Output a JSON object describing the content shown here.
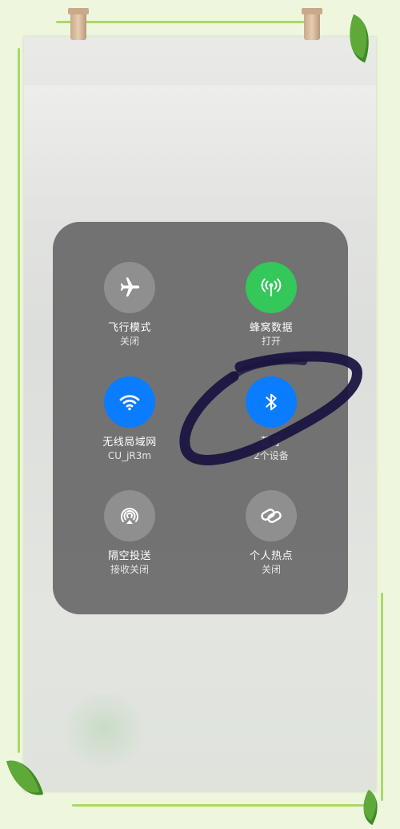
{
  "panel": {
    "tiles": [
      {
        "label": "飞行模式",
        "status": "关闭",
        "icon": "airplane-icon",
        "state": "off"
      },
      {
        "label": "蜂窝数据",
        "status": "打开",
        "icon": "cellular-antenna-icon",
        "state": "on"
      },
      {
        "label": "无线局域网",
        "status": "CU_jR3m",
        "icon": "wifi-icon",
        "state": "on"
      },
      {
        "label": "蓝牙",
        "status": "2个设备",
        "icon": "bluetooth-icon",
        "state": "on"
      },
      {
        "label": "隔空投送",
        "status": "接收关闭",
        "icon": "airdrop-icon",
        "state": "off"
      },
      {
        "label": "个人热点",
        "status": "关闭",
        "icon": "hotspot-link-icon",
        "state": "off"
      }
    ]
  },
  "colors": {
    "on_green": "#34c759",
    "on_blue": "#0a7cff",
    "off_gray": "#8f8f8f",
    "panel": "#6e6e6e",
    "annotation": "#1a1540"
  }
}
